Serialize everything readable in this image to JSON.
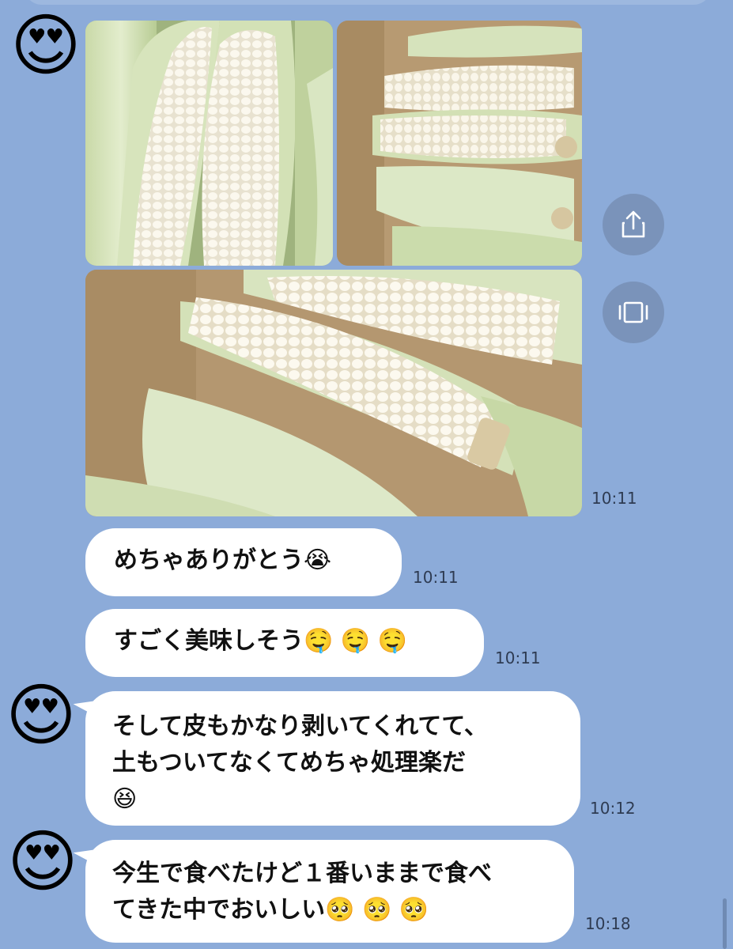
{
  "avatar_emoji": "😍",
  "photos": [
    {
      "alt": "corn-photo-1"
    },
    {
      "alt": "corn-photo-2"
    },
    {
      "alt": "corn-photo-3"
    }
  ],
  "photo_time": "10:11",
  "side_buttons": {
    "share_icon": "share-icon",
    "gallery_icon": "gallery-icon"
  },
  "messages": [
    {
      "text": "めちゃありがとう",
      "emoji": "😭",
      "time": "10:11",
      "side": "sent"
    },
    {
      "text": "すごく美味しそう",
      "emoji": "🤤 🤤 🤤",
      "time": "10:11",
      "side": "sent"
    },
    {
      "line1": "そして皮もかなり剥いてくれてて、",
      "line2": "土もついてなくてめちゃ処理楽だ",
      "emoji": "😆",
      "time": "10:12",
      "side": "received"
    },
    {
      "line1": "今生で食べたけど１番いままで食べ",
      "line2": "てきた中でおいしい",
      "emoji": "🥺 🥺 🥺",
      "time": "10:18",
      "side": "received"
    }
  ],
  "colors": {
    "background": "#8CABD9",
    "bubble": "#FFFFFF",
    "button": "#7A93BA"
  }
}
